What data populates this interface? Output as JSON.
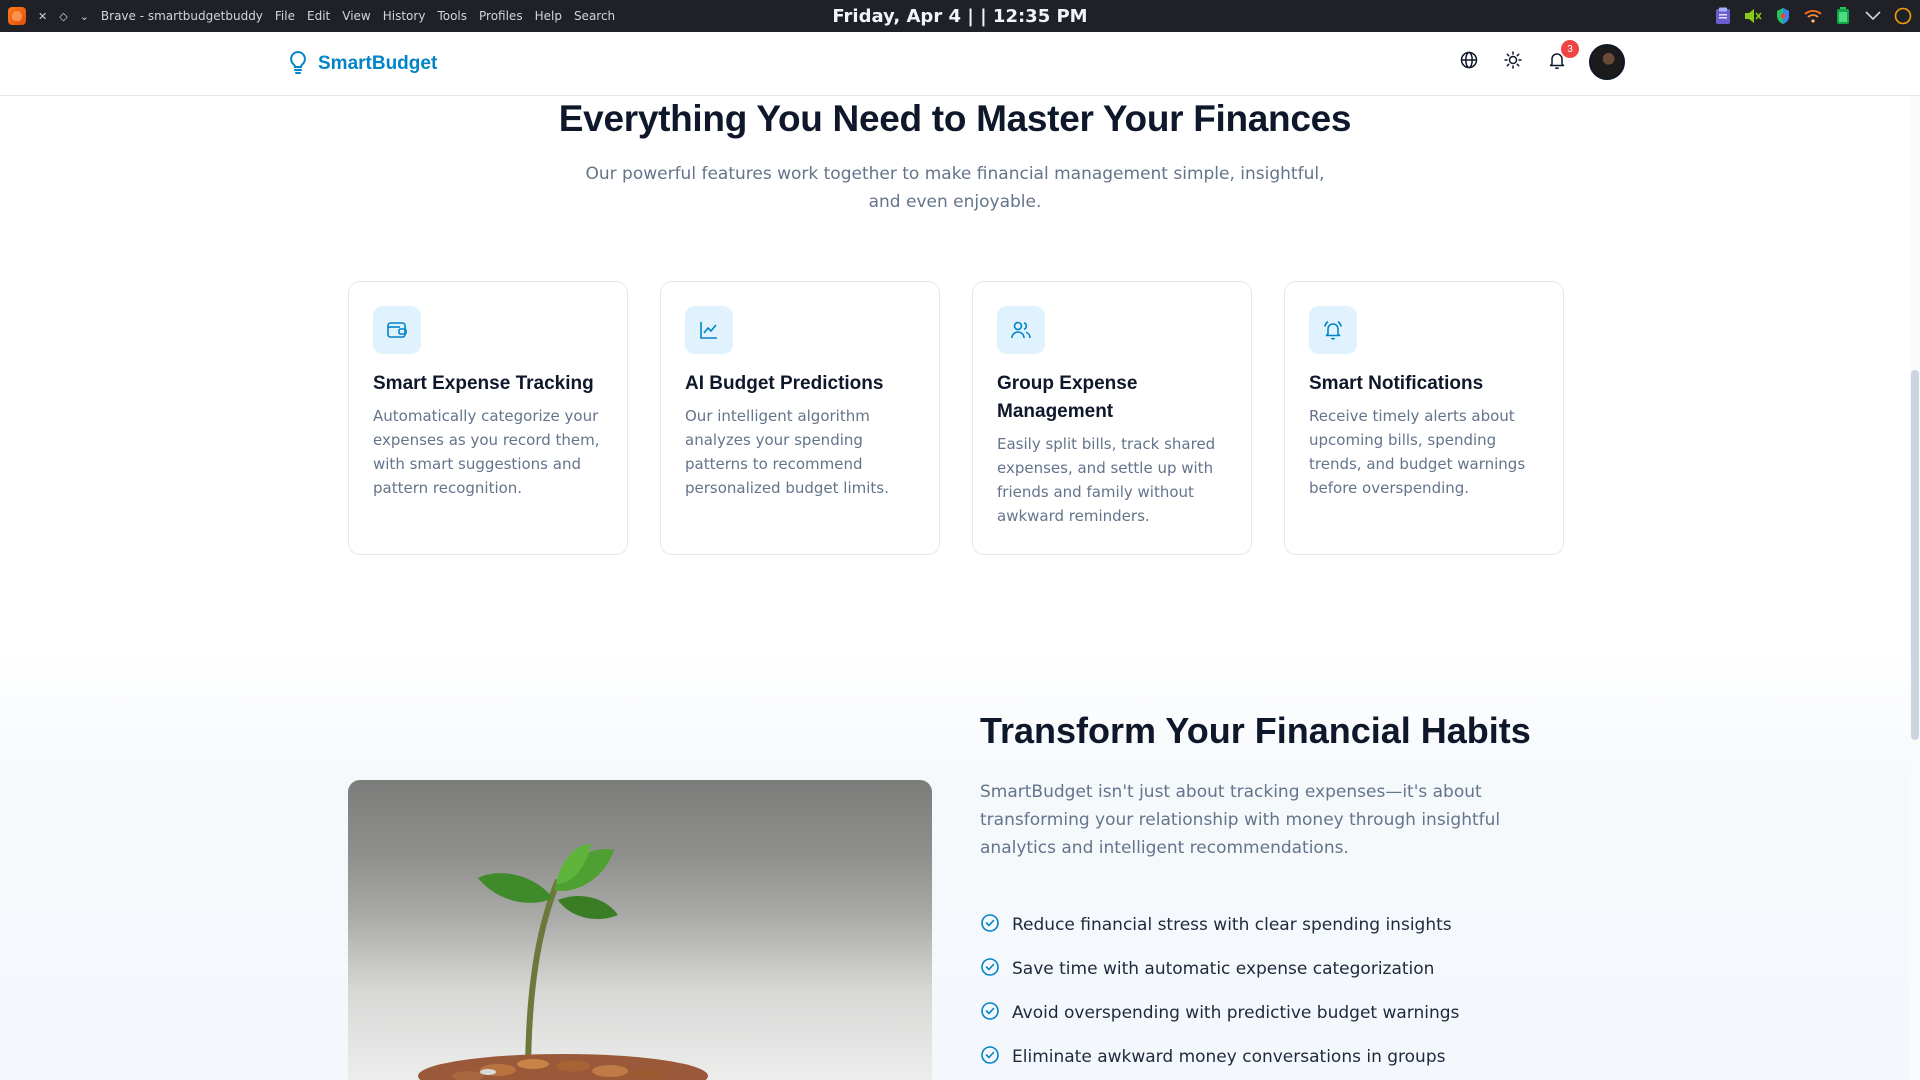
{
  "os_bar": {
    "app_title": "Brave - smartbudgetbuddy",
    "menus": [
      "File",
      "Edit",
      "View",
      "History",
      "Tools",
      "Profiles",
      "Help",
      "Search"
    ],
    "clock": "Friday, Apr 4 | | 12:35 PM",
    "tray_icons": [
      "clipboard-icon",
      "muted-speaker-icon",
      "shield-icon",
      "wifi-icon",
      "battery-icon",
      "chevron-down-icon",
      "status-circle-icon"
    ]
  },
  "header": {
    "brand_name": "SmartBudget",
    "brand_icon": "lightbulb-icon",
    "actions": [
      "globe-icon",
      "sun-icon",
      "bell-icon"
    ],
    "notification_count": "3"
  },
  "features": {
    "title": "Everything You Need to Master Your Finances",
    "subtitle": "Our powerful features work together to make financial management simple, insightful, and even enjoyable.",
    "cards": [
      {
        "icon": "wallet-icon",
        "title": "Smart Expense Tracking",
        "description": "Automatically categorize your expenses as you record them, with smart suggestions and pattern recognition."
      },
      {
        "icon": "line-chart-icon",
        "title": "AI Budget Predictions",
        "description": "Our intelligent algorithm analyzes your spending patterns to recommend personalized budget limits."
      },
      {
        "icon": "users-icon",
        "title": "Group Expense Management",
        "description": "Easily split bills, track shared expenses, and settle up with friends and family without awkward reminders."
      },
      {
        "icon": "bell-ring-icon",
        "title": "Smart Notifications",
        "description": "Receive timely alerts about upcoming bills, spending trends, and budget warnings before overspending."
      }
    ]
  },
  "transform": {
    "title": "Transform Your Financial Habits",
    "description": "SmartBudget isn't just about tracking expenses—it's about transforming your relationship with money through insightful analytics and intelligent recommendations.",
    "benefits": [
      "Reduce financial stress with clear spending insights",
      "Save time with automatic expense categorization",
      "Avoid overspending with predictive budget warnings",
      "Eliminate awkward money conversations in groups"
    ]
  },
  "colors": {
    "brand": "#0284c7",
    "icon_bg": "#e0f2fe",
    "badge": "#ef4444",
    "heading": "#0f172a",
    "muted_text": "#64748b"
  }
}
